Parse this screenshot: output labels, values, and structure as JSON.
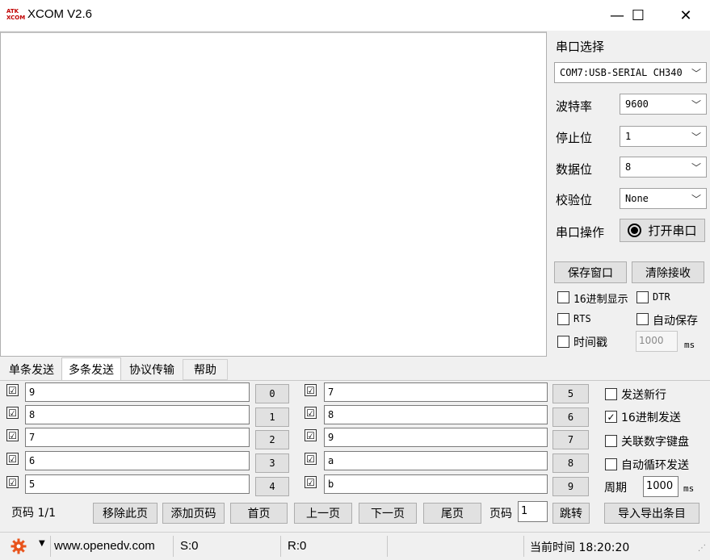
{
  "window": {
    "logo_top": "ATK",
    "logo_bottom": "XCOM",
    "title": "XCOM V2.6",
    "minimize": "—",
    "maximize": "☐",
    "close": "✕"
  },
  "serial": {
    "select_label": "串口选择",
    "port": "COM7:USB-SERIAL CH340",
    "baud_label": "波特率",
    "baud": "9600",
    "stop_label": "停止位",
    "stop": "1",
    "data_label": "数据位",
    "data": "8",
    "parity_label": "校验位",
    "parity": "None",
    "op_label": "串口操作",
    "open_button": "打开串口",
    "save_window": "保存窗口",
    "clear_recv": "清除接收",
    "hex_display": "16进制显示",
    "dtr": "DTR",
    "rts": "RTS",
    "auto_save": "自动保存",
    "timestamp": "时间戳",
    "timestamp_value": "1000",
    "ms": "ms"
  },
  "tabs": [
    "单条发送",
    "多条发送",
    "协议传输",
    "帮助"
  ],
  "multi": {
    "left_rows": [
      {
        "checked": "☑",
        "value": "9",
        "num": "0"
      },
      {
        "checked": "☑",
        "value": "8",
        "num": "1"
      },
      {
        "checked": "☑",
        "value": "7",
        "num": "2"
      },
      {
        "checked": "☑",
        "value": "6",
        "num": "3"
      },
      {
        "checked": "☑",
        "value": "5",
        "num": "4"
      }
    ],
    "right_rows": [
      {
        "checked": "☑",
        "value": "7",
        "num": "5"
      },
      {
        "checked": "☑",
        "value": "8",
        "num": "6"
      },
      {
        "checked": "☑",
        "value": "9",
        "num": "7"
      },
      {
        "checked": "☑",
        "value": "a",
        "num": "8"
      },
      {
        "checked": "☑",
        "value": "b",
        "num": "9"
      }
    ],
    "send_newline": "发送新行",
    "hex_send": "16进制发送",
    "link_keyboard": "关联数字键盘",
    "auto_loop": "自动循环发送",
    "period_label": "周期",
    "period_value": "1000",
    "ms": "ms",
    "page_label": "页码 1/1",
    "remove_page": "移除此页",
    "add_page": "添加页码",
    "first": "首页",
    "prev": "上一页",
    "next": "下一页",
    "last": "尾页",
    "page_no_label": "页码",
    "page_no_value": "1",
    "jump": "跳转",
    "import_export": "导入导出条目"
  },
  "status": {
    "url": "www.openedv.com",
    "sent": "S:0",
    "received": "R:0",
    "time_label": "当前时间 18:20:20"
  },
  "colors": {
    "gear": "#e8541d"
  }
}
